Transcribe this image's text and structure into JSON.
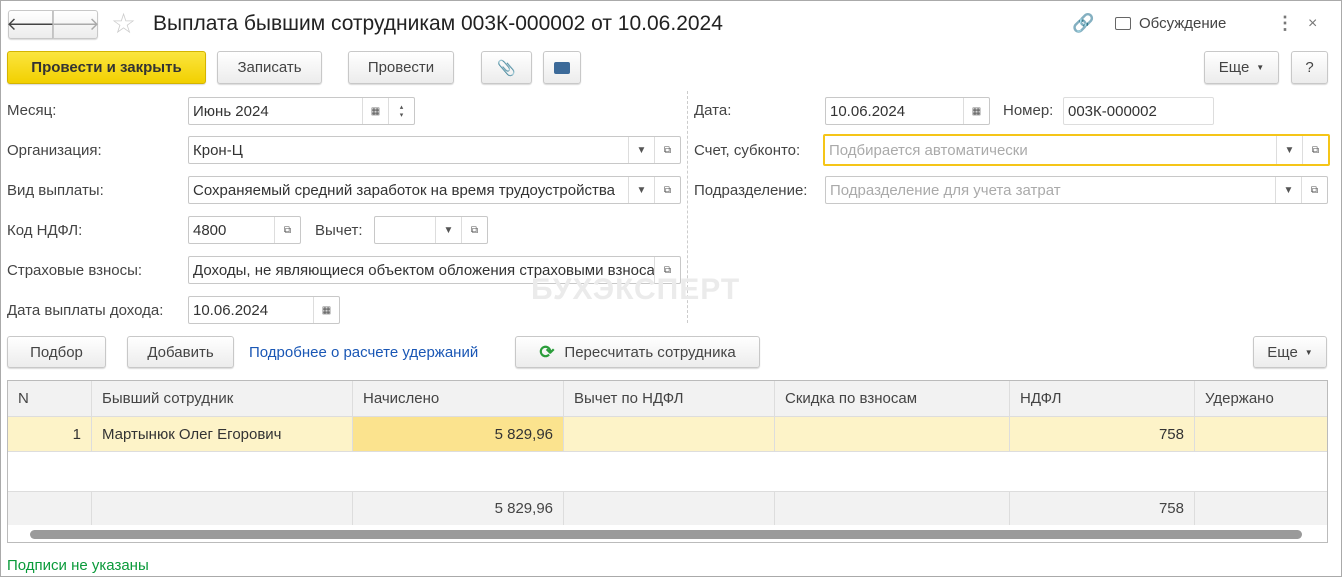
{
  "header": {
    "title": "Выплата бывшим сотрудникам 003К-000002 от 10.06.2024",
    "discussion": "Обсуждение"
  },
  "toolbar": {
    "post_close": "Провести и закрыть",
    "save": "Записать",
    "post": "Провести",
    "more": "Еще",
    "help": "?"
  },
  "form": {
    "month_label": "Месяц:",
    "month": "Июнь 2024",
    "org_label": "Организация:",
    "org": "Крон-Ц",
    "pay_type_label": "Вид выплаты:",
    "pay_type": "Сохраняемый средний заработок на время трудоустройства",
    "ndfl_code_label": "Код НДФЛ:",
    "ndfl_code": "4800",
    "deduction_label": "Вычет:",
    "deduction": "",
    "insurance_label": "Страховые взносы:",
    "insurance": "Доходы, не являющиеся объектом обложения страховыми взносами",
    "pay_date_label": "Дата выплаты дохода:",
    "pay_date": "10.06.2024",
    "date_label": "Дата:",
    "date": "10.06.2024",
    "number_label": "Номер:",
    "number": "003К-000002",
    "account_label": "Счет, субконто:",
    "account_placeholder": "Подбирается автоматически",
    "division_label": "Подразделение:",
    "division_placeholder": "Подразделение для учета затрат"
  },
  "watermark": "БУХЭКСПЕРТ",
  "table_toolbar": {
    "pick": "Подбор",
    "add": "Добавить",
    "details_link": "Подробнее о расчете удержаний",
    "recalc": "Пересчитать сотрудника",
    "more": "Еще"
  },
  "table": {
    "columns": [
      "N",
      "Бывший сотрудник",
      "Начислено",
      "Вычет по НДФЛ",
      "Скидка по взносам",
      "НДФЛ",
      "Удержано"
    ],
    "rows": [
      {
        "n": "1",
        "employee": "Мартынюк Олег Егорович",
        "accrued": "5 829,96",
        "deduction": "",
        "discount": "",
        "ndfl": "758",
        "withheld": ""
      }
    ],
    "totals": {
      "accrued": "5 829,96",
      "ndfl": "758"
    }
  },
  "footer": {
    "signatures_link": "Подписи не указаны"
  },
  "colors": {
    "accent": "#f2d000",
    "selected_row": "#fdf3c8",
    "selected_cell": "#fbe38e",
    "link": "#1a57b5",
    "green_link": "#0a9a3a"
  }
}
